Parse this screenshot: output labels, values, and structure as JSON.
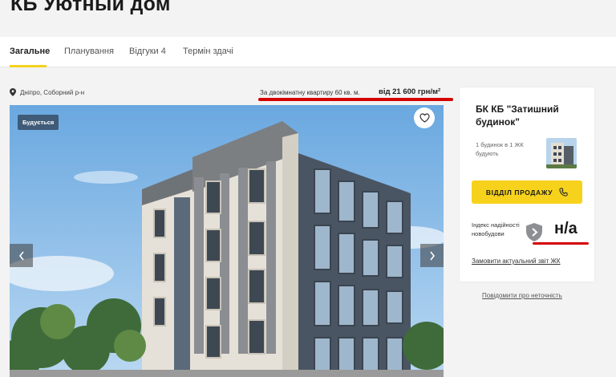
{
  "header": {
    "title": "КБ Уютный дом"
  },
  "tabs": [
    {
      "label": "Загальне",
      "active": true
    },
    {
      "label": "Планування",
      "active": false
    },
    {
      "label": "Відгуки 4",
      "active": false
    },
    {
      "label": "Термін здачі",
      "active": false
    }
  ],
  "location": {
    "text": "Дніпро, Соборний р-н",
    "icon": "map-pin-icon"
  },
  "price": {
    "note": "За двокімнатну квартиру 60 кв. м.",
    "value": "від 21 600 грн/м²"
  },
  "photo": {
    "status_badge": "Будується",
    "fav_icon": "heart-icon",
    "prev_icon": "chevron-left-icon",
    "next_icon": "chevron-right-icon"
  },
  "developer": {
    "name": "БК КБ \"Затишний будинок\"",
    "info": "1 будинок в 1 ЖК будують",
    "sales_button": "ВІДДІЛ ПРОДАЖУ",
    "reliability_label": "Індекс надійності новобудови",
    "reliability_value": "н/а",
    "report_link": "Замовити актуальний звіт ЖК"
  },
  "report_inaccuracy": "Повідомити про неточність",
  "colors": {
    "accent_yellow": "#f6d21c",
    "badge_blue": "#3f5b78",
    "annotation_red": "#d50000"
  }
}
